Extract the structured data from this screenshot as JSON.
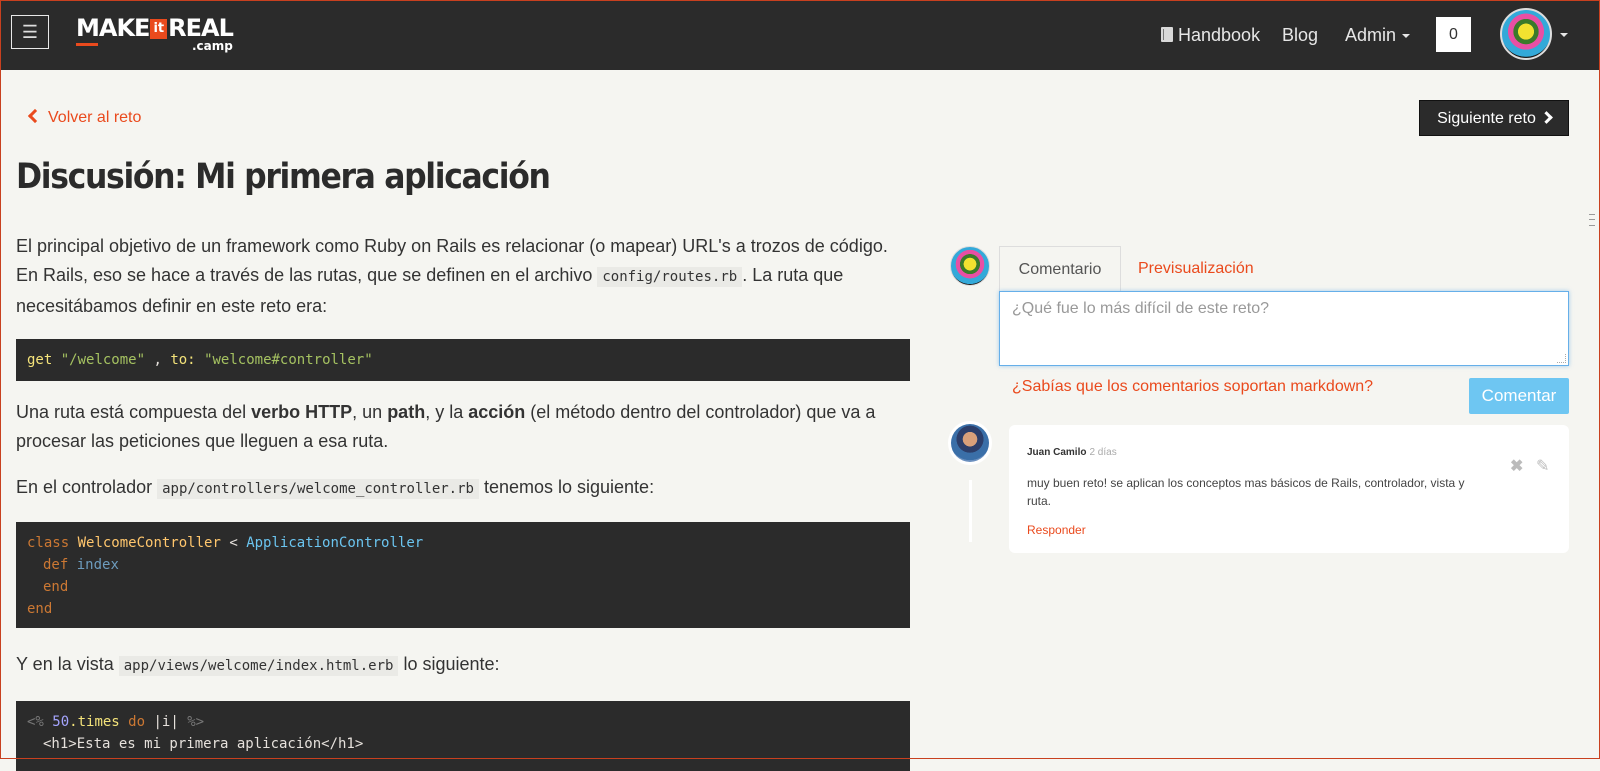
{
  "header": {
    "logo_make": "MAKE",
    "logo_it": "it",
    "logo_real": "REAL",
    "logo_camp": ".camp",
    "nav": {
      "handbook": "Handbook",
      "blog": "Blog",
      "admin": "Admin"
    },
    "notifications_count": "0"
  },
  "page": {
    "back_label": "Volver al reto",
    "next_label": "Siguiente reto",
    "title": "Discusión: Mi primera aplicación"
  },
  "article": {
    "p1_a": "El principal objetivo de un framework como Ruby on Rails es relacionar (o mapear) URL's a trozos de código. En Rails, eso se hace a través de las rutas, que se definen en el archivo ",
    "p1_code": "config/routes.rb",
    "p1_b": ". La ruta que necesitábamos definir en este reto era:",
    "code1": {
      "get": "get",
      "path": "\"/welcome\"",
      "sep": " , ",
      "to": "to:",
      "target": "\"welcome#controller\""
    },
    "p2_a": "Una ruta está compuesta del ",
    "p2_b1": "verbo HTTP",
    "p2_c": ", un ",
    "p2_b2": "path",
    "p2_d": ", y la ",
    "p2_b3": "acción",
    "p2_e": " (el método dentro del controlador) que va a procesar las peticiones que lleguen a esa ruta.",
    "p3_a": "En el controlador ",
    "p3_code": "app/controllers/welcome_controller.rb",
    "p3_b": " tenemos lo siguiente:",
    "code2": {
      "class_kw": "class",
      "class_name": "WelcomeController",
      "lt": " < ",
      "parent": "ApplicationController",
      "def_kw": "def",
      "method": "index",
      "end1": "end",
      "end2": "end"
    },
    "p4_a": "Y en la vista ",
    "p4_code": "app/views/welcome/index.html.erb",
    "p4_b": " lo siguiente:",
    "code3": {
      "open": "<%",
      "num": "50",
      "times": ".times",
      "do_kw": "do",
      "block": "|i|",
      "close": "%>",
      "h1_line": "<h1>Esta es mi primera aplicación</h1>"
    }
  },
  "comments": {
    "tab_comment": "Comentario",
    "tab_preview": "Previsualización",
    "placeholder": "¿Qué fue lo más difícil de este reto?",
    "markdown_hint": "¿Sabías que los comentarios soportan markdown?",
    "submit_label": "Comentar",
    "items": [
      {
        "author": "Juan Camilo",
        "when": "2 días",
        "body": "muy buen reto! se aplican los conceptos mas básicos de Rails, controlador, vista y ruta.",
        "reply_label": "Responder"
      }
    ]
  },
  "icons": [
    "menu-icon",
    "book-icon",
    "caret-down-icon",
    "chevron-left-icon",
    "chevron-right-icon",
    "delete-icon",
    "pencil-icon"
  ]
}
